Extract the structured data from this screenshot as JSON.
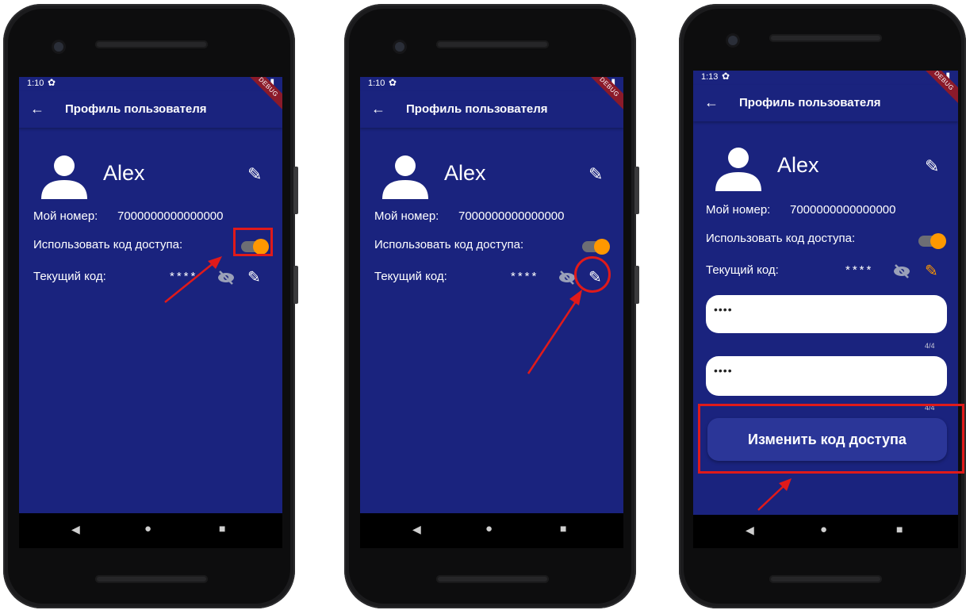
{
  "status": {
    "phone1_time": "1:10",
    "phone2_time": "1:10",
    "phone3_time": "1:13",
    "gear": "✿",
    "signal": "▼▮"
  },
  "appbar": {
    "back": "←",
    "title": "Профиль пользователя",
    "debug": "DEBUG"
  },
  "profile": {
    "name": "Alex",
    "number_label": "Мой номер:",
    "number_value": "7000000000000000",
    "use_code_label": "Использовать код доступа:",
    "current_code_label": "Текущий код:",
    "masked_code": "****",
    "pen": "✎"
  },
  "form": {
    "new_code_dots": "••••",
    "confirm_code_dots": "••••",
    "new_code_counter": "4/4",
    "confirm_code_counter": "4/4",
    "change_button": "Изменить код доступа"
  },
  "nav": {
    "back": "◀",
    "home": "●",
    "recents": "■"
  },
  "colors": {
    "app_background": "#1a237e",
    "accent": "#ff9800",
    "annotation": "#e01a1a"
  }
}
